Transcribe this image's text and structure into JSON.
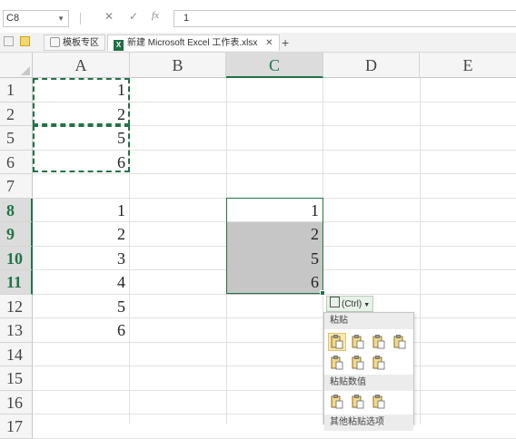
{
  "formula_bar": {
    "name_box": "C8",
    "cancel_glyph": "✕",
    "enter_glyph": "✓",
    "fx_label": "fx",
    "formula_value": "1"
  },
  "tabs": {
    "home_label": "模板专区",
    "file_label": "新建 Microsoft Excel 工作表.xlsx",
    "close_glyph": "✕",
    "add_glyph": "+"
  },
  "columns": [
    "A",
    "B",
    "C",
    "D",
    "E"
  ],
  "selected_column": "C",
  "rows": [
    {
      "header": "1",
      "a": "1",
      "c": ""
    },
    {
      "header": "2",
      "a": "2",
      "c": ""
    },
    {
      "header": "5",
      "a": "5",
      "c": ""
    },
    {
      "header": "6",
      "a": "6",
      "c": ""
    },
    {
      "header": "7",
      "a": "",
      "c": ""
    },
    {
      "header": "8",
      "a": "1",
      "c": "1"
    },
    {
      "header": "9",
      "a": "2",
      "c": "2"
    },
    {
      "header": "10",
      "a": "3",
      "c": "5"
    },
    {
      "header": "11",
      "a": "4",
      "c": "6"
    },
    {
      "header": "12",
      "a": "5",
      "c": ""
    },
    {
      "header": "13",
      "a": "6",
      "c": ""
    },
    {
      "header": "14",
      "a": "",
      "c": ""
    },
    {
      "header": "15",
      "a": "",
      "c": ""
    },
    {
      "header": "16",
      "a": "",
      "c": ""
    },
    {
      "header": "17",
      "a": "",
      "c": ""
    }
  ],
  "selected_rows": [
    "8",
    "9",
    "10",
    "11"
  ],
  "paste_menu": {
    "ctrl_label": "(Ctrl)",
    "section_paste": "粘贴",
    "section_values": "粘贴数值",
    "section_other": "其他粘贴选项",
    "icons_paste": [
      "paste-icon",
      "paste-formulas-icon",
      "paste-formulas-number-format-icon",
      "keep-source-formatting-icon",
      "no-borders-icon",
      "keep-column-widths-icon",
      "transpose-icon"
    ],
    "icons_values": [
      "paste-values-icon",
      "values-number-format-icon",
      "values-source-formatting-icon"
    ]
  },
  "colors": {
    "accent": "#217346",
    "selection_fill": "#c6c6c6",
    "header_bg": "#f5f5f5"
  }
}
